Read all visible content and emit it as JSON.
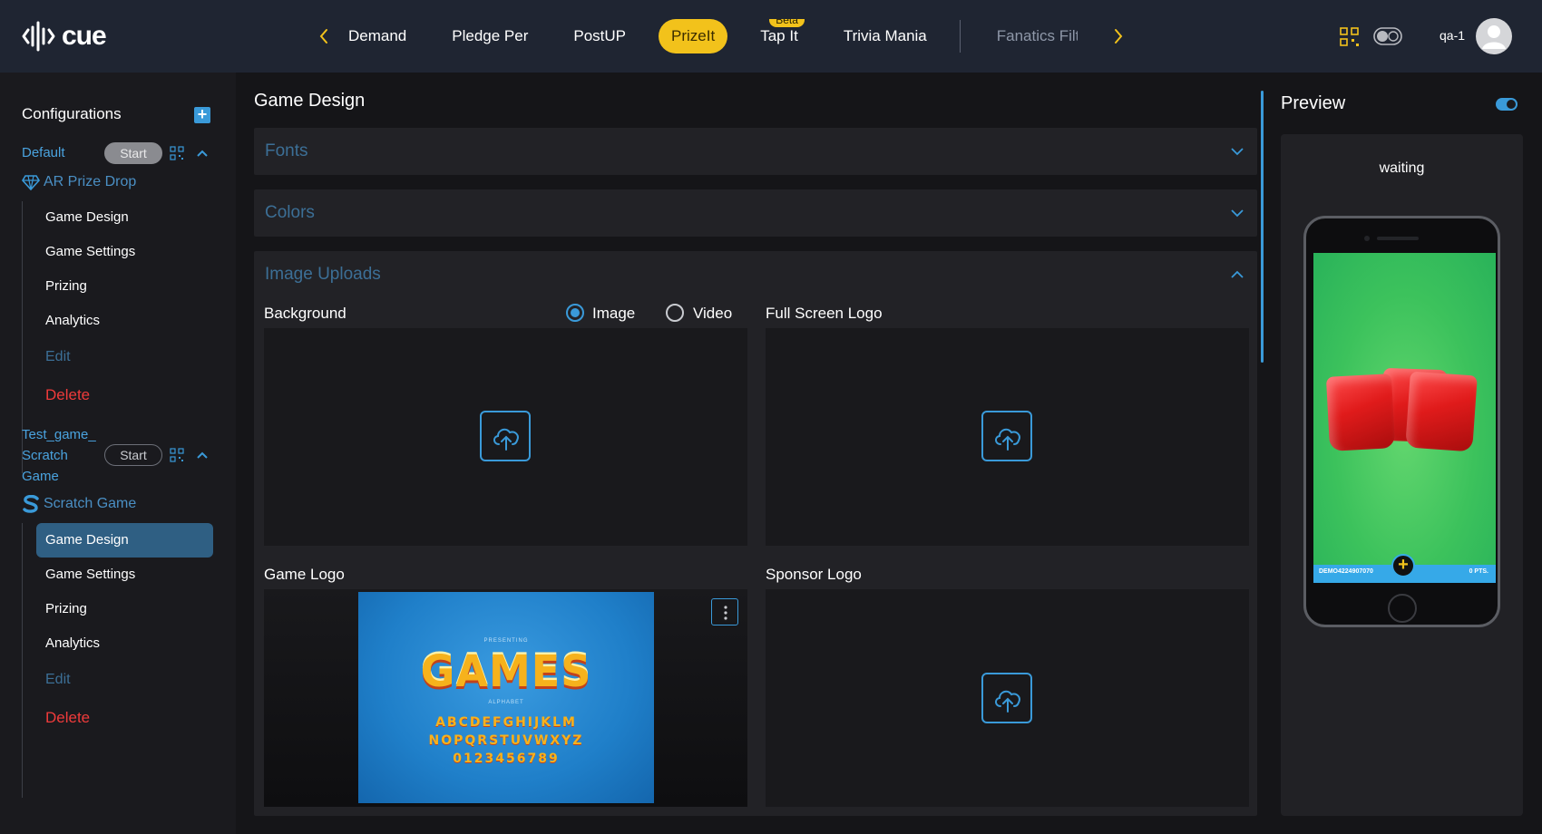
{
  "header": {
    "logo_text": "cue",
    "tabs": [
      {
        "label": "Demand",
        "state": "normal",
        "badge": ""
      },
      {
        "label": "Pledge Per",
        "state": "normal",
        "badge": ""
      },
      {
        "label": "PostUP",
        "state": "normal",
        "badge": ""
      },
      {
        "label": "PrizeIt",
        "state": "active",
        "badge": ""
      },
      {
        "label": "Tap It",
        "state": "normal",
        "badge": "Beta"
      },
      {
        "label": "Trivia Mania",
        "state": "normal",
        "badge": ""
      },
      {
        "label": "Fanatics Filters",
        "state": "dim",
        "badge": ""
      }
    ],
    "user_name": "qa-1",
    "accent_color": "#f2c21b"
  },
  "sidebar": {
    "title": "Configurations",
    "configs": [
      {
        "name_lines": [
          "Default"
        ],
        "start_label": "Start",
        "game_type": "AR Prize Drop",
        "items": [
          "Game Design",
          "Game Settings",
          "Prizing",
          "Analytics"
        ],
        "edit_label": "Edit",
        "delete_label": "Delete"
      },
      {
        "name_lines": [
          "Test_game_",
          "Scratch",
          "Game"
        ],
        "start_label": "Start",
        "game_type": "Scratch Game",
        "items": [
          "Game Design",
          "Game Settings",
          "Prizing",
          "Analytics"
        ],
        "edit_label": "Edit",
        "delete_label": "Delete"
      }
    ]
  },
  "main": {
    "title": "Game Design",
    "panels": {
      "fonts": "Fonts",
      "colors": "Colors",
      "image_uploads": "Image Uploads"
    },
    "uploads": {
      "background_label": "Background",
      "radio_image": "Image",
      "radio_video": "Video",
      "full_screen_logo_label": "Full Screen Logo",
      "game_logo_label": "Game Logo",
      "sponsor_logo_label": "Sponsor Logo"
    },
    "game_logo_image": {
      "presenting": "PRESENTING",
      "word": "GAMES",
      "alphabet": "ALPHABET",
      "line1": "ABCDEFGHIJKLM",
      "line2": "NOPQRSTUVWXYZ",
      "line3": "0123456789"
    }
  },
  "preview": {
    "title": "Preview",
    "status": "waiting",
    "bar_left": "DEMO4224907070",
    "bar_right": "0 PTS."
  }
}
